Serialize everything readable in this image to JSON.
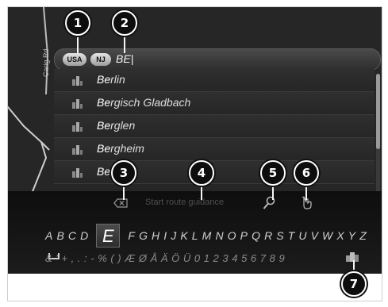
{
  "map": {
    "street_label": "Carig Rd"
  },
  "search": {
    "country_pill": "USA",
    "state_pill": "NJ",
    "input_text": "BE|"
  },
  "results": [
    {
      "match": "Be",
      "rest": "rlin"
    },
    {
      "match": "Be",
      "rest": "rgisch Gladbach"
    },
    {
      "match": "Be",
      "rest": "rglen"
    },
    {
      "match": "Be",
      "rest": "rgheim"
    },
    {
      "match": "Be",
      "rest": "rlin"
    }
  ],
  "toolbar": {
    "backspace_icon": "backspace-icon",
    "start_guidance_label": "Start route guidance",
    "search_icon": "magnifier-icon",
    "hand_icon": "hand-pointer-icon"
  },
  "keyboard": {
    "letters_before": [
      "A",
      "B",
      "C",
      "D"
    ],
    "selected": "E",
    "letters_after": [
      "F",
      "G",
      "H",
      "I",
      "J",
      "K",
      "L",
      "M",
      "N",
      "O",
      "P",
      "Q",
      "R",
      "S",
      "T",
      "U",
      "V",
      "W",
      "X",
      "Y",
      "Z"
    ],
    "symbols_row": "& ' + , . : - % ( ) Æ Ø Å Ä Ö Ü 0 1 2 3 4 5 6 7 8 9",
    "category_icon": "character-set-icon"
  },
  "callouts": [
    "1",
    "2",
    "3",
    "4",
    "5",
    "6",
    "7"
  ],
  "colors": {
    "background": "#1b1b1b",
    "callout": "#0d0d0d",
    "highlight": "#ffffff"
  }
}
